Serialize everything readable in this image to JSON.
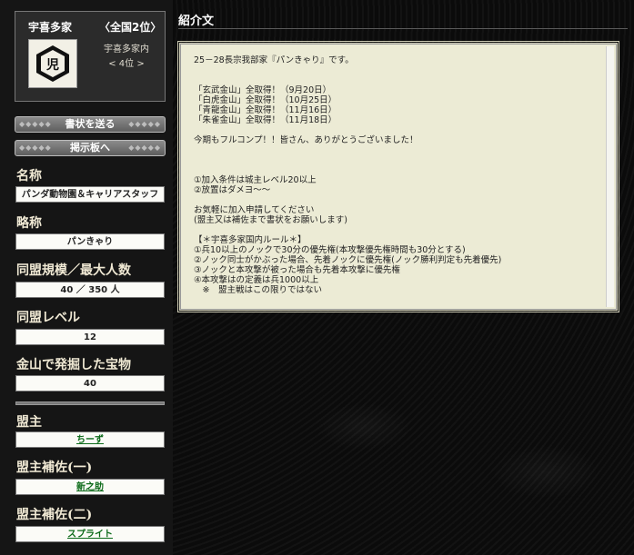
{
  "profile": {
    "name": "宇喜多家",
    "rank": "〈全国2位〉",
    "family_label": "宇喜多家内",
    "family_rank": "< 4位 >",
    "crest_icon": "family-crest-icon"
  },
  "buttons": {
    "send_letter": "書状を送る",
    "board": "掲示板へ"
  },
  "fields": {
    "name_label": "名称",
    "name_value": "パンダ動物園＆キャリアスタッフ",
    "short_label": "略称",
    "short_value": "パンきゃり",
    "scale_label": "同盟規模／最大人数",
    "scale_value": "40 ／ 350 人",
    "level_label": "同盟レベル",
    "level_value": "12",
    "treasure_label": "金山で発掘した宝物",
    "treasure_value": "40",
    "leader_label": "盟主",
    "leader_value": "ちーず",
    "assist1_label": "盟主補佐(一)",
    "assist1_value": "新之助",
    "assist2_label": "盟主補佐(二)",
    "assist2_value": "スプライト"
  },
  "intro": {
    "title": "紹介文",
    "lines": [
      "25－28長宗我部家『パンきゃり』です。",
      "",
      "",
      "「玄武金山」全取得！（9月20日）",
      "「白虎金山」全取得！（10月25日）",
      "「青龍金山」全取得！（11月16日）",
      "「朱雀金山」全取得！（11月18日）",
      "",
      "今期もフルコンプ！！皆さん、ありがとうございました！",
      "",
      "",
      "",
      "①加入条件は城主レベル20以上",
      "②放置はダメヨ～～",
      "",
      "お気軽に加入申請してください",
      "(盟主又は補佐まで書状をお願いします)",
      "",
      "【＊宇喜多家国内ルール＊】",
      "①兵10以上のノックで30分の優先権(本攻撃優先権時間も30分とする)",
      "②ノック同士がかぶった場合、先着ノックに優先権(ノック勝利判定も先着優先)",
      "③ノックと本攻撃が被った場合も先着本攻撃に優先権",
      "④本攻撃はの定義は兵1000以上",
      "　※　盟主戦はこの限りではない"
    ]
  }
}
